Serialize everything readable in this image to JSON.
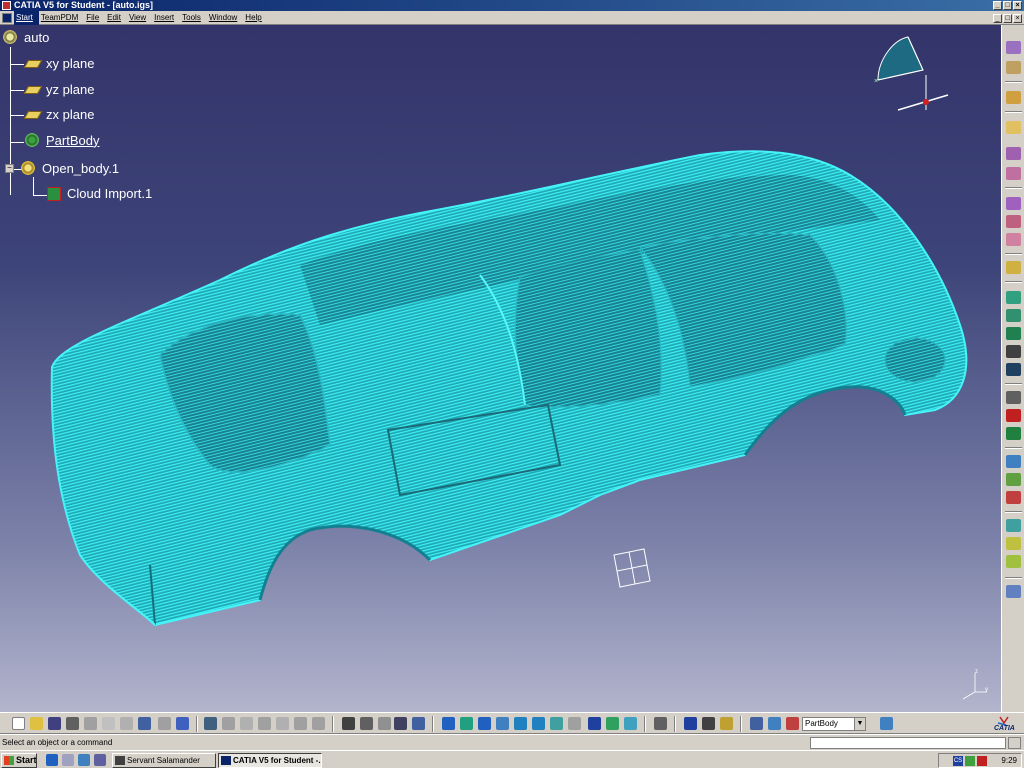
{
  "window": {
    "title": "CATIA V5 for Student - [auto.igs]",
    "controls": [
      "_",
      "□",
      "×"
    ]
  },
  "menu": {
    "items": [
      "Start",
      "TeamPDM",
      "File",
      "Edit",
      "View",
      "Insert",
      "Tools",
      "Window",
      "Help"
    ]
  },
  "tree": {
    "root": "auto",
    "items": [
      {
        "label": "xy plane",
        "icon": "plane-icon"
      },
      {
        "label": "yz plane",
        "icon": "plane-icon"
      },
      {
        "label": "zx plane",
        "icon": "plane-icon"
      },
      {
        "label": "PartBody",
        "icon": "partbody-gear-icon"
      },
      {
        "label": "Open_body.1",
        "icon": "open-body-icon"
      },
      {
        "label": "Cloud Import.1",
        "icon": "cloud-import-icon"
      }
    ]
  },
  "viewport": {
    "model": "car-point-cloud",
    "model_color": "#33e0e8"
  },
  "toolbar": {
    "body_selector": "PartBody",
    "logo": "CATIA"
  },
  "status": {
    "message": "Select an object or a command"
  },
  "taskbar": {
    "start_label": "Start",
    "tasks": [
      "Servant Salamander",
      "CATIA V5 for Student -..."
    ],
    "clock": "9:29",
    "tray_lang": "CS"
  }
}
